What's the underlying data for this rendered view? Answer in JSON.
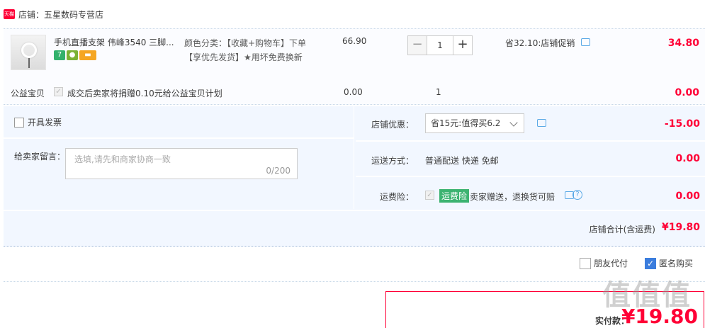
{
  "shop": {
    "badge": "天猫",
    "name": "店铺：五星数码专营店"
  },
  "product": {
    "title": "手机直播支架 伟峰3540 三脚...",
    "icons": [
      "7",
      "android",
      "card"
    ],
    "sku_line1": "颜色分类：【收藏+购物车】下单",
    "sku_line2": "【享优先发货】★用坏免费换新",
    "unit_price": "66.90",
    "qty_minus": "−",
    "qty_value": "1",
    "qty_plus": "+",
    "promo": "省32.10:店铺促销",
    "total": "34.80"
  },
  "charity": {
    "label": "公益宝贝",
    "check": "✓",
    "text": "成交后卖家将捐赠0.10元给公益宝贝计划",
    "price": "0.00",
    "qty": "1",
    "total": "0.00"
  },
  "options": {
    "invoice_label": "开具发票",
    "message_label": "给卖家留言：",
    "message_placeholder": "选填,请先和商家协商一致",
    "message_count": "0/200",
    "discount_label": "店铺优惠：",
    "discount_value": "省15元:值得买6.2",
    "discount_amount": "-15.00",
    "shipping_label": "运送方式：",
    "shipping_value": "普通配送 快递 免邮",
    "shipping_amount": "0.00",
    "insurance_label": "运费险：",
    "insurance_check": "✓",
    "insurance_tag": "运费险",
    "insurance_text": "卖家赠送，退换货可赔",
    "insurance_help": "?",
    "insurance_amount": "0.00",
    "shop_total_label": "店铺合计(含运费)",
    "shop_total_value": "¥19.80"
  },
  "payment": {
    "friend_pay": "朋友代付",
    "anonymous": "匿名购买",
    "anonymous_check": "✓",
    "actual_label": "实付款：",
    "actual_amount": "¥19.80"
  },
  "watermark": "值值值",
  "colors": {
    "accent": "#ff0036",
    "panel": "#f2f7ff",
    "link": "#5aa9e6",
    "check": "#3b7ddd"
  }
}
